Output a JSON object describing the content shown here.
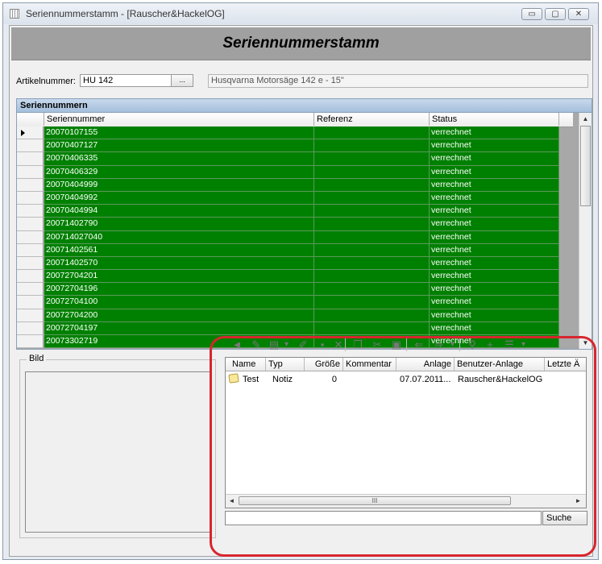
{
  "window": {
    "title": "Seriennummerstamm - [Rauscher&HackelOG]",
    "minimize_glyph": "▭",
    "maximize_glyph": "▢",
    "close_glyph": "✕"
  },
  "header": {
    "title": "Seriennummerstamm"
  },
  "article": {
    "label": "Artikelnummer:",
    "value": "HU 142",
    "button_label": "...",
    "description": "Husqvarna Motorsäge 142 e - 15\""
  },
  "grid": {
    "caption": "Seriennummern",
    "columns": [
      "Seriennummer",
      "Referenz",
      "Status"
    ],
    "rows": [
      {
        "serial": "20070107155",
        "ref": "",
        "status": "verrechnet"
      },
      {
        "serial": "20070407127",
        "ref": "",
        "status": "verrechnet"
      },
      {
        "serial": "20070406335",
        "ref": "",
        "status": "verrechnet"
      },
      {
        "serial": "20070406329",
        "ref": "",
        "status": "verrechnet"
      },
      {
        "serial": "20070404999",
        "ref": "",
        "status": "verrechnet"
      },
      {
        "serial": "20070404992",
        "ref": "",
        "status": "verrechnet"
      },
      {
        "serial": "20070404994",
        "ref": "",
        "status": "verrechnet"
      },
      {
        "serial": "20071402790",
        "ref": "",
        "status": "verrechnet"
      },
      {
        "serial": "200714027040",
        "ref": "",
        "status": "verrechnet"
      },
      {
        "serial": "20071402561",
        "ref": "",
        "status": "verrechnet"
      },
      {
        "serial": "20071402570",
        "ref": "",
        "status": "verrechnet"
      },
      {
        "serial": "20072704201",
        "ref": "",
        "status": "verrechnet"
      },
      {
        "serial": "20072704196",
        "ref": "",
        "status": "verrechnet"
      },
      {
        "serial": "20072704100",
        "ref": "",
        "status": "verrechnet"
      },
      {
        "serial": "20072704200",
        "ref": "",
        "status": "verrechnet"
      },
      {
        "serial": "20072704197",
        "ref": "",
        "status": "verrechnet"
      },
      {
        "serial": "20073302719",
        "ref": "",
        "status": "verrechnet"
      }
    ],
    "row_color": "#008000",
    "scroll_up_glyph": "▲",
    "scroll_down_glyph": "▼"
  },
  "bild": {
    "label": "Bild"
  },
  "toolbar": {
    "icons": [
      {
        "name": "back-arrow-icon",
        "glyph": "◄"
      },
      {
        "name": "new-note-icon",
        "glyph": "✎"
      },
      {
        "name": "new-document-icon",
        "glyph": "▤"
      },
      {
        "name": "new-document-dropdown-icon",
        "glyph": "▾"
      },
      {
        "name": "edit-icon",
        "glyph": "✐"
      },
      {
        "name": "save-icon",
        "glyph": "▪"
      },
      {
        "name": "delete-icon",
        "glyph": "✕"
      },
      {
        "name": "copy-icon",
        "glyph": "❐"
      },
      {
        "name": "cut-icon",
        "glyph": "✂"
      },
      {
        "name": "paste-icon",
        "glyph": "▣"
      },
      {
        "name": "arrow-left-icon",
        "glyph": "⇐"
      },
      {
        "name": "arrow-right-icon",
        "glyph": "⇒"
      },
      {
        "name": "navigate-dropdown-icon",
        "glyph": "▾"
      },
      {
        "name": "binoculars-icon",
        "glyph": "⚲"
      },
      {
        "name": "add-icon",
        "glyph": "+"
      },
      {
        "name": "list-view-icon",
        "glyph": "☰"
      },
      {
        "name": "list-view-dropdown-icon",
        "glyph": "▾"
      }
    ]
  },
  "attachments": {
    "columns": [
      "Name",
      "Typ",
      "Größe",
      "Kommentar",
      "Anlage",
      "Benutzer-Anlage",
      "Letzte Ä"
    ],
    "rows": [
      {
        "name": "Test",
        "type": "Notiz",
        "size": "0",
        "comment": "",
        "created": "07.07.2011...",
        "created_by": "Rauscher&HackelOG",
        "last_changed": ""
      }
    ],
    "hscroll_grip": "III",
    "scroll_left_glyph": "◄",
    "scroll_right_glyph": "►"
  },
  "search": {
    "value": "",
    "button_label": "Suche"
  },
  "highlight_color": "#d8262e"
}
